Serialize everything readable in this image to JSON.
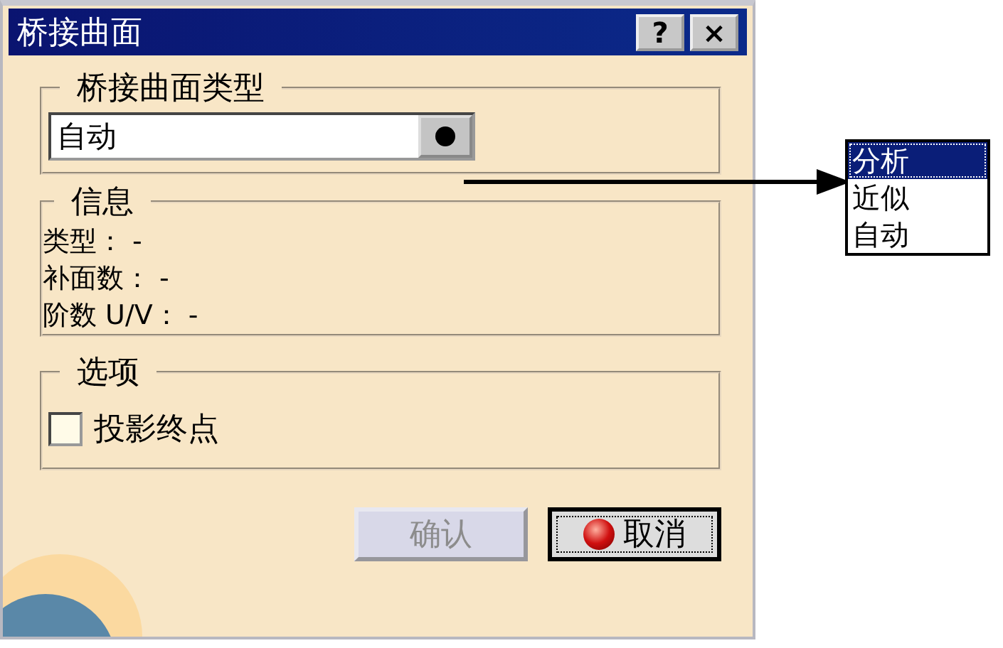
{
  "window": {
    "title": "桥接曲面",
    "title_buttons": [
      "?",
      "×"
    ]
  },
  "type_group": {
    "title": "桥接曲面类型",
    "combo": {
      "value": "自动"
    }
  },
  "info_group": {
    "title": "信息",
    "lines": [
      "类型： -",
      "补面数： -",
      "阶数 U/V： -"
    ]
  },
  "options_group": {
    "title": "选项",
    "checkboxes": [
      {
        "label": "投影终点",
        "checked": false
      }
    ]
  },
  "buttons": [
    {
      "label": "确认",
      "disabled": true,
      "kind": "ok"
    },
    {
      "label": "取消",
      "disabled": false,
      "kind": "cancel"
    }
  ],
  "dropdown_list": {
    "items": [
      {
        "label": "分析",
        "selected": true
      },
      {
        "label": "近似",
        "selected": false
      },
      {
        "label": "自动",
        "selected": false
      }
    ]
  }
}
